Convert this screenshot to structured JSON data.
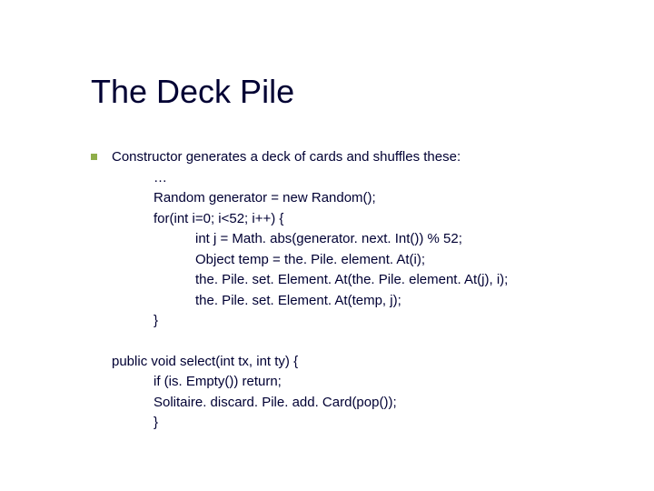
{
  "title": "The Deck Pile",
  "bullet": {
    "intro": "Constructor generates a deck of cards and shuffles these:",
    "lines": [
      "…",
      "Random generator = new Random();",
      "for(int i=0; i<52; i++) {"
    ],
    "inner": [
      "int j = Math. abs(generator. next. Int()) % 52;",
      "Object temp = the. Pile. element. At(i);",
      "the. Pile. set. Element. At(the. Pile. element. At(j), i);",
      "the. Pile. set. Element. At(temp, j);"
    ],
    "close": "}"
  },
  "method": {
    "sig": "public void select(int tx, int ty) {",
    "body": [
      "if (is. Empty()) return;",
      "Solitaire. discard. Pile. add. Card(pop());",
      "}"
    ]
  }
}
